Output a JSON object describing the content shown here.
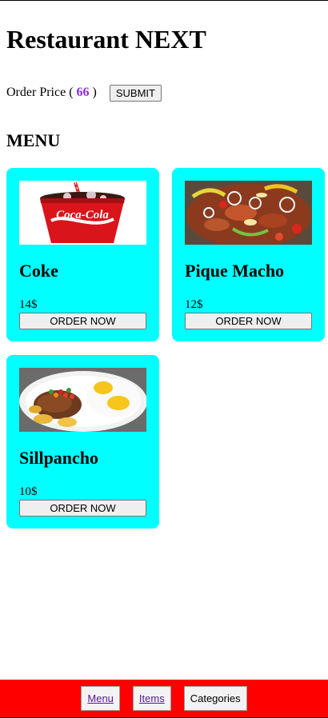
{
  "header": {
    "title": "Restaurant NEXT"
  },
  "order": {
    "label_prefix": "Order Price (",
    "price": "66",
    "label_suffix": ")",
    "submit_label": "SUBMIT"
  },
  "menu": {
    "heading": "MENU",
    "items": [
      {
        "name": "Coke",
        "price": "14$",
        "button_label": "ORDER NOW",
        "image": "coke-cup-image"
      },
      {
        "name": "Pique Macho",
        "price": "12$",
        "button_label": "ORDER NOW",
        "image": "pique-macho-image"
      },
      {
        "name": "Sillpancho",
        "price": "10$",
        "button_label": "ORDER NOW",
        "image": "sillpancho-image"
      }
    ]
  },
  "footer": {
    "tabs": [
      {
        "label": "Menu"
      },
      {
        "label": "Items"
      },
      {
        "label": "Categories"
      }
    ]
  },
  "colors": {
    "card_background": "#00ffff",
    "footer_background": "#ff0000",
    "price_accent": "#8a2be2",
    "visited_link": "#551a8b"
  }
}
